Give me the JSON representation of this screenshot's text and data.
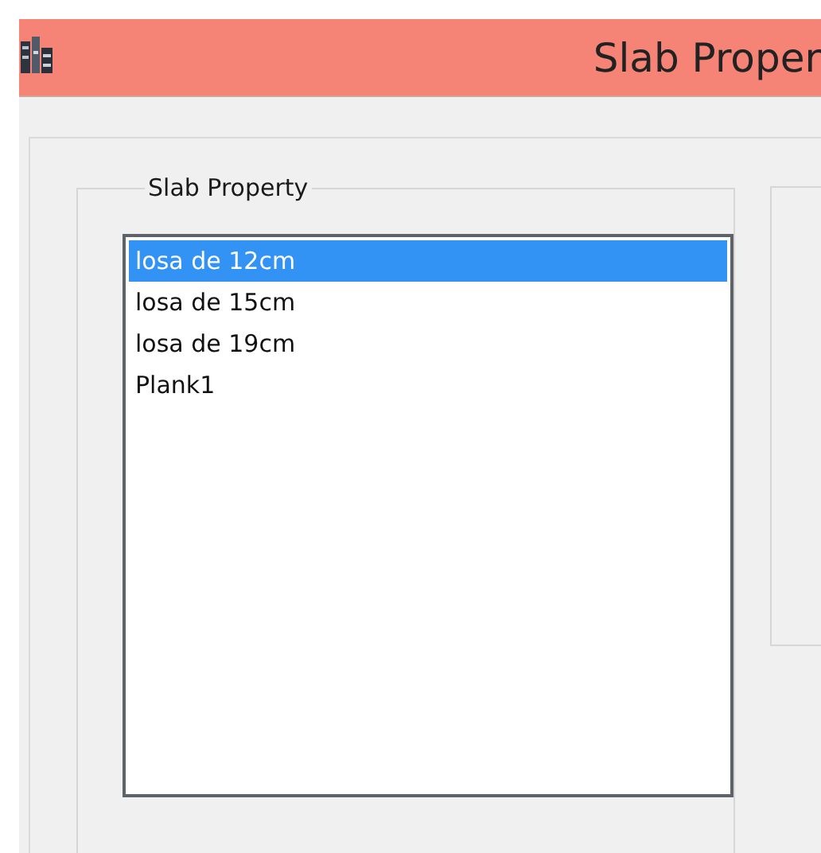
{
  "window": {
    "title": "Slab Proper"
  },
  "group": {
    "title": "Slab Property"
  },
  "slab_list": {
    "items": [
      {
        "label": "losa de 12cm",
        "selected": true
      },
      {
        "label": "losa de 15cm",
        "selected": false
      },
      {
        "label": "losa de 19cm",
        "selected": false
      },
      {
        "label": "Plank1",
        "selected": false
      }
    ]
  }
}
